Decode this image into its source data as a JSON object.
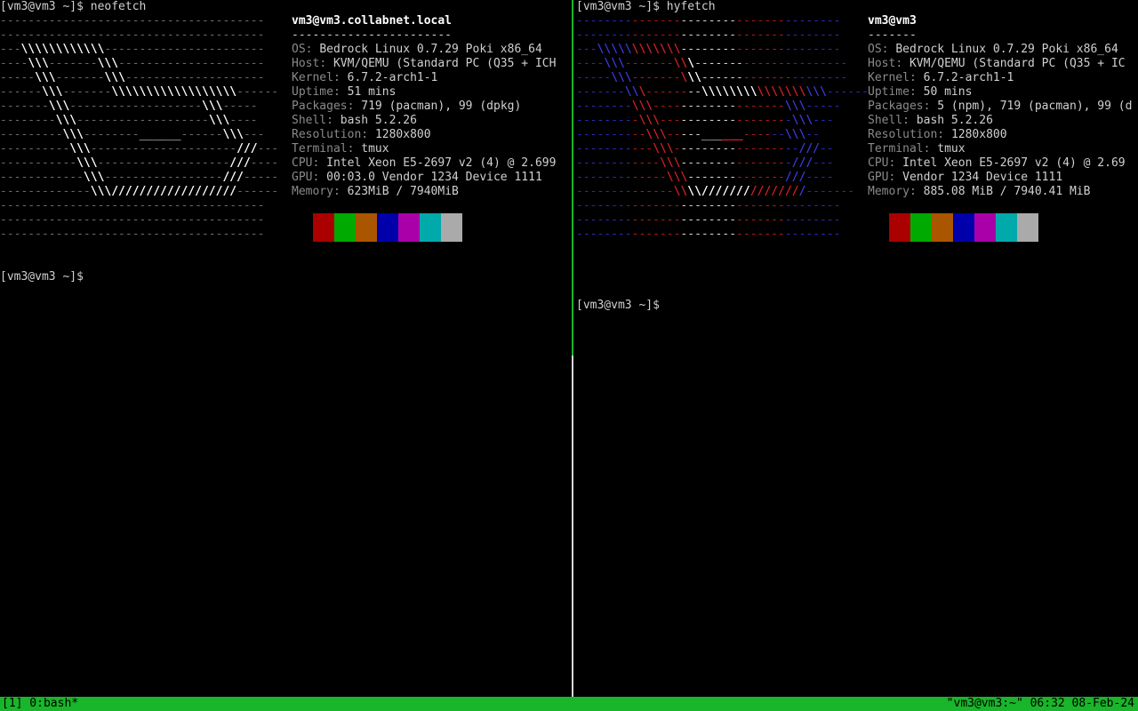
{
  "left_pane": {
    "command_line": "[vm3@vm3 ~]$ neofetch",
    "title": "vm3@vm3.collabnet.local",
    "separator": "-----------------------",
    "info": [
      {
        "label": "OS",
        "value": "Bedrock Linux 0.7.29 Poki x86_64"
      },
      {
        "label": "Host",
        "value": "KVM/QEMU (Standard PC (Q35 + ICH"
      },
      {
        "label": "Kernel",
        "value": "6.7.2-arch1-1"
      },
      {
        "label": "Uptime",
        "value": "51 mins"
      },
      {
        "label": "Packages",
        "value": "719 (pacman), 99 (dpkg)"
      },
      {
        "label": "Shell",
        "value": "bash 5.2.26"
      },
      {
        "label": "Resolution",
        "value": "1280x800"
      },
      {
        "label": "Terminal",
        "value": "tmux"
      },
      {
        "label": "CPU",
        "value": "Intel Xeon E5-2697 v2 (4) @ 2.699"
      },
      {
        "label": "GPU",
        "value": "00:03.0 Vendor 1234 Device 1111"
      },
      {
        "label": "Memory",
        "value": "623MiB / 7940MiB"
      }
    ],
    "colors": [
      "#aa0000",
      "#00aa00",
      "#aa5500",
      "#0000aa",
      "#aa00aa",
      "#00aaaa",
      "#aaaaaa"
    ],
    "next_prompt": "[vm3@vm3 ~]$"
  },
  "right_pane": {
    "command_line": "[vm3@vm3 ~]$ hyfetch",
    "title": "vm3@vm3",
    "separator": "-------",
    "info": [
      {
        "label": "OS",
        "value": "Bedrock Linux 0.7.29 Poki x86_64"
      },
      {
        "label": "Host",
        "value": "KVM/QEMU (Standard PC (Q35 + IC"
      },
      {
        "label": "Kernel",
        "value": "6.7.2-arch1-1"
      },
      {
        "label": "Uptime",
        "value": "50 mins"
      },
      {
        "label": "Packages",
        "value": "5 (npm), 719 (pacman), 99 (d"
      },
      {
        "label": "Shell",
        "value": "bash 5.2.26"
      },
      {
        "label": "Resolution",
        "value": "1280x800"
      },
      {
        "label": "Terminal",
        "value": "tmux"
      },
      {
        "label": "CPU",
        "value": "Intel Xeon E5-2697 v2 (4) @ 2.69"
      },
      {
        "label": "GPU",
        "value": "Vendor 1234 Device 1111"
      },
      {
        "label": "Memory",
        "value": "885.08 MiB / 7940.41 MiB"
      }
    ],
    "colors": [
      "#aa0000",
      "#00aa00",
      "#aa5500",
      "#0000aa",
      "#aa00aa",
      "#00aaaa",
      "#aaaaaa"
    ],
    "next_prompt": "[vm3@vm3 ~]$"
  },
  "statusbar": {
    "left": "[1] 0:bash*",
    "right": "\"vm3@vm3:~\" 06:32 08-Feb-24"
  },
  "accent_color": "#19b52a"
}
